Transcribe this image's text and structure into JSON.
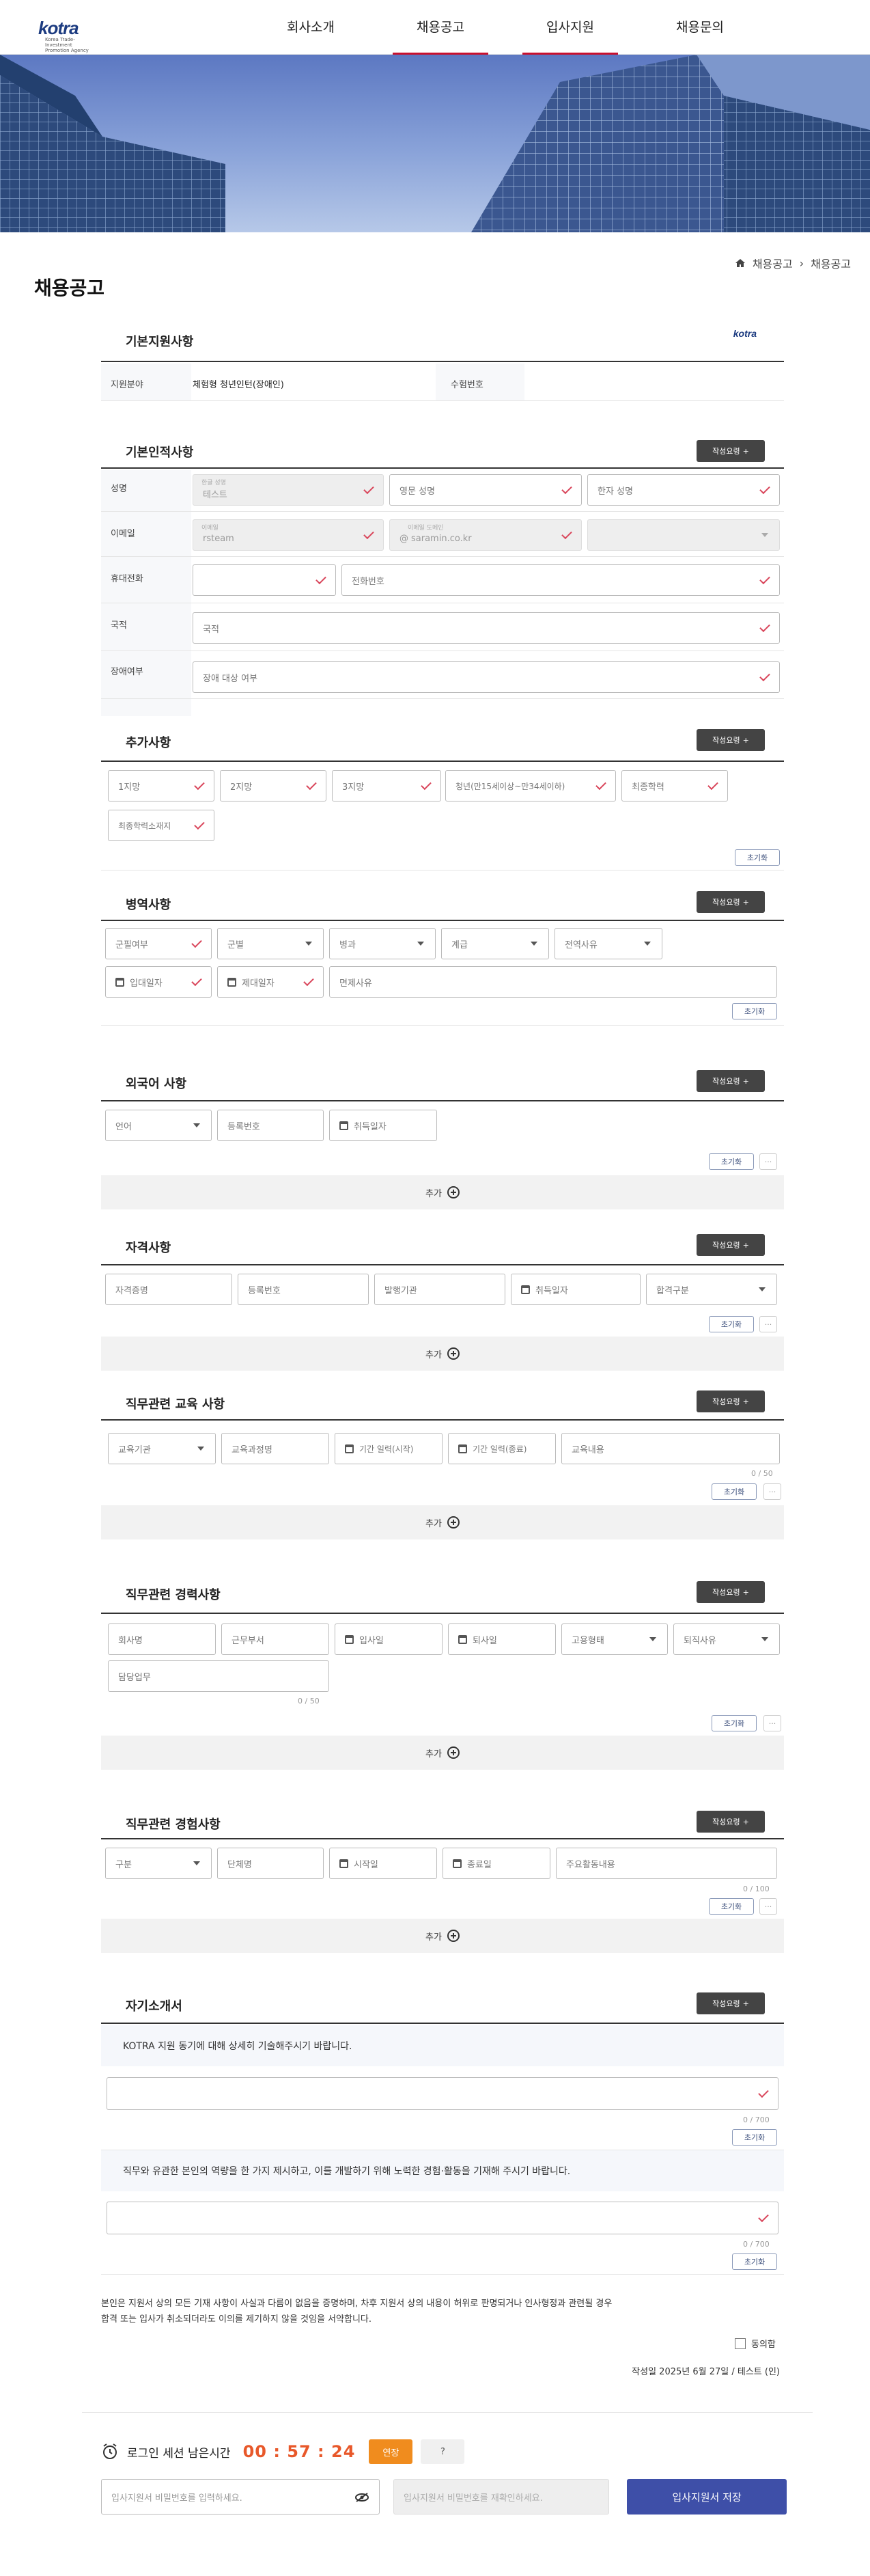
{
  "header": {
    "logo": "kotra",
    "logo_sub": "Korea Trade-Investment Promotion Agency",
    "nav": [
      "회사소개",
      "채용공고",
      "입사지원",
      "채용문의"
    ]
  },
  "page": {
    "title": "채용공고",
    "breadcrumb": [
      "채용공고",
      "채용공고"
    ]
  },
  "guide_btn": "작성요령",
  "basic_app": {
    "title": "기본지원사항",
    "field_label": "지원분야",
    "field_value": "체험형 청년인턴(장애인)",
    "exam_label": "수험번호",
    "exam_value": ""
  },
  "personal": {
    "title": "기본인적사항",
    "name_label": "성명",
    "name_float": "한글 성명",
    "name_value": "테스트",
    "name_en": "영문 성명",
    "name_cn": "한자 성명",
    "email_label": "이메일",
    "email_float": "이메일",
    "email_value": "rsteam",
    "email_domain_float": "이메일 도메인",
    "email_domain": "saramin.co.kr",
    "phone_label": "휴대전화",
    "phone_ph": "전화번호",
    "nation_label": "국적",
    "nation_ph": "국적",
    "disab_label": "장애여부",
    "disab_ph": "장애 대상 여부"
  },
  "extra": {
    "title": "추가사항",
    "chips": [
      "1지망",
      "2지망",
      "3지망",
      "청년(만15세이상~만34세이하)",
      "최종학력",
      "최종학력소재지"
    ],
    "reset": "초기화"
  },
  "military": {
    "title": "병역사항",
    "f1": "군필여부",
    "f2": "군별",
    "f3": "병과",
    "f4": "계급",
    "f5": "전역사유",
    "f6": "입대일자",
    "f7": "제대일자",
    "f8": "면제사유",
    "reset": "초기화"
  },
  "lang": {
    "title": "외국어 사항",
    "f1": "언어",
    "f2": "등록번호",
    "f3": "취득일자",
    "reset": "초기화",
    "add": "추가"
  },
  "cert": {
    "title": "자격사항",
    "f1": "자격증명",
    "f2": "등록번호",
    "f3": "발행기관",
    "f4": "취득일자",
    "f5": "합격구분",
    "reset": "초기화",
    "add": "추가"
  },
  "edu": {
    "title": "직무관련 교육 사항",
    "f1": "교육기관",
    "f2": "교육과정명",
    "f3": "기간 일력(시작)",
    "f4": "기간 일력(종료)",
    "f5": "교육내용",
    "count": "0 / 50",
    "reset": "초기화",
    "add": "추가"
  },
  "career": {
    "title": "직무관련 경력사항",
    "f1": "회사명",
    "f2": "근무부서",
    "f3": "입사일",
    "f4": "퇴사일",
    "f5": "고용형태",
    "f6": "퇴직사유",
    "f7": "담당업무",
    "count": "0 / 50",
    "reset": "초기화",
    "add": "추가"
  },
  "exp": {
    "title": "직무관련 경험사항",
    "f1": "구분",
    "f2": "단체명",
    "f3": "시작일",
    "f4": "종료일",
    "f5": "주요활동내용",
    "count": "0 / 100",
    "reset": "초기화",
    "add": "추가"
  },
  "intro": {
    "title": "자기소개서",
    "q1": "KOTRA 지원 동기에 대해 상세히 기술해주시기 바랍니다.",
    "q2": "직무와 유관한 본인의 역량을 한 가지 제시하고, 이를 개발하기 위해 노력한 경험·활동을 기재해 주시기 바랍니다.",
    "count1": "0 / 700",
    "count2": "0 / 700",
    "reset": "초기화"
  },
  "agree": {
    "line1": "본인은 지원서 상의 모든 기재 사항이 사실과 다름이 없음을 증명하며, 차후 지원서 상의 내용이 허위로 판명되거나 인사형정과 관련될 경우",
    "line2": "합격 또는 입사가 취소되더라도 이의를 제기하지 않을 것임을 서약합니다.",
    "agree_label": "동의함",
    "signed": "작성일 2025년 6월 27일 / 테스트 (인)"
  },
  "session": {
    "label": "로그인 세션 남은시간",
    "time": "00 : 57 : 24",
    "extend": "연장",
    "help": "?"
  },
  "footer": {
    "pw_ph": "입사지원서 비밀번호를 입력하세요.",
    "pw2_ph": "입사지원서 비밀번호를 재확인하세요.",
    "save": "입사지원서 저장"
  }
}
